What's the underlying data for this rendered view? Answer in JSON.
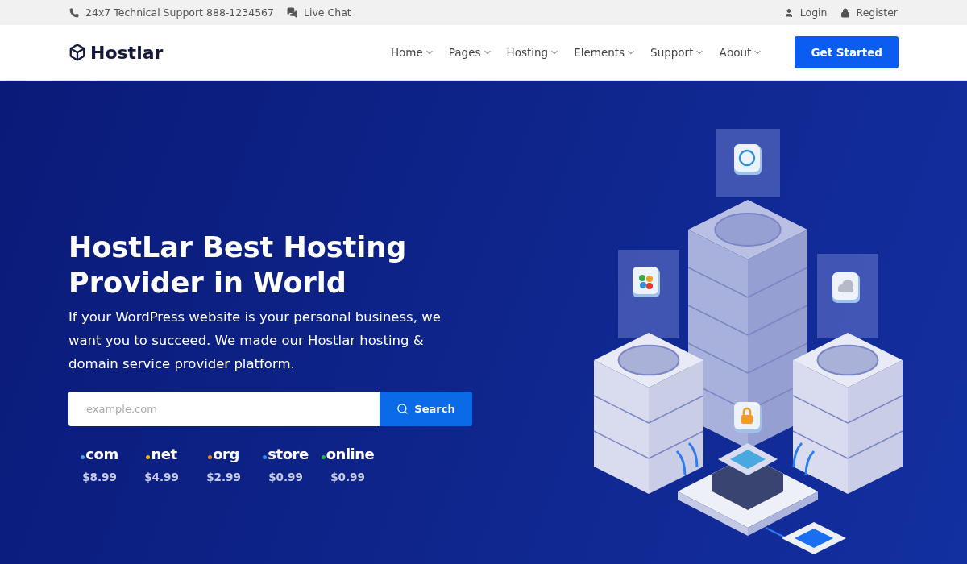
{
  "topbar": {
    "support": "24x7 Technical Support 888-1234567",
    "chat": "Live Chat",
    "login": "Login",
    "register": "Register"
  },
  "nav": {
    "logo": "Hostlar",
    "items": [
      {
        "label": "Home",
        "dropdown": true
      },
      {
        "label": "Pages",
        "dropdown": true
      },
      {
        "label": "Hosting",
        "dropdown": true
      },
      {
        "label": "Elements",
        "dropdown": true
      },
      {
        "label": "Support",
        "dropdown": true
      },
      {
        "label": "About",
        "dropdown": true
      }
    ],
    "cta": "Get Started"
  },
  "hero": {
    "title": "HostLar Best Hosting Provider in World",
    "text": "If your WordPress website is your personal business, we want you to succeed. We made our Hostlar hosting & domain service provider platform.",
    "search": {
      "placeholder": "example.com",
      "button": "Search"
    },
    "domains": [
      {
        "name": "com",
        "price": "$8.99",
        "color": "#4fa8e8"
      },
      {
        "name": "net",
        "price": "$4.99",
        "color": "#f5b800"
      },
      {
        "name": "org",
        "price": "$2.99",
        "color": "#f08a1c"
      },
      {
        "name": "store",
        "price": "$0.99",
        "color": "#3a8de0"
      },
      {
        "name": "online",
        "price": "$0.99",
        "color": "#2bb34a"
      }
    ]
  }
}
